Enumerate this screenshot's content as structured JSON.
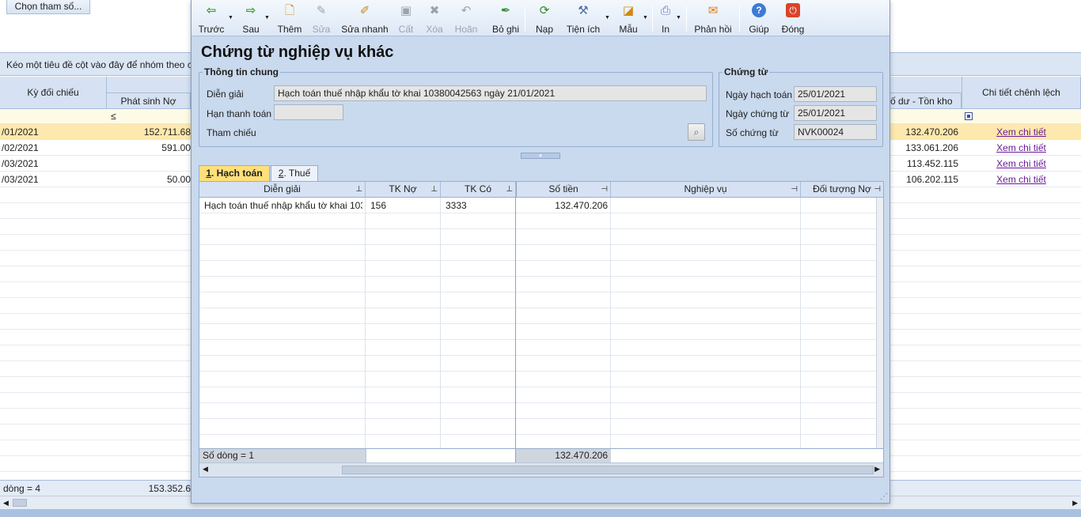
{
  "background": {
    "params_button": "Chọn tham số...",
    "group_bar_text": "Kéo một tiêu đề cột vào đây để nhóm theo c",
    "headers": {
      "ky_doi_chieu": "Kỳ đối chiếu",
      "phat_sinh_no": "Phát sinh Nợ",
      "so_du_ton_kho": "ố dư - Tồn kho",
      "chi_tiet": "Chi tiết chênh lệch"
    },
    "filter_symbol": "≤",
    "rows": [
      {
        "period": "/01/2021",
        "debit": "152.711.68",
        "balance": "132.470.206",
        "link": "Xem chi tiết"
      },
      {
        "period": "/02/2021",
        "debit": "591.00",
        "balance": "133.061.206",
        "link": "Xem chi tiết"
      },
      {
        "period": "/03/2021",
        "debit": "",
        "balance": "113.452.115",
        "link": "Xem chi tiết"
      },
      {
        "period": "/03/2021",
        "debit": "50.00",
        "balance": "106.202.115",
        "link": "Xem chi tiết"
      }
    ],
    "footer_count": "dòng = 4",
    "footer_debit": "153.352.6"
  },
  "toolbar": {
    "truoc": "Trước",
    "sau": "Sau",
    "them": "Thêm",
    "sua": "Sửa",
    "sua_nhanh": "Sửa nhanh",
    "cat": "Cất",
    "xoa": "Xóa",
    "hoan": "Hoãn",
    "bo_ghi": "Bỏ ghi",
    "nap": "Nạp",
    "tien_ich": "Tiện ích",
    "mau": "Mẫu",
    "in": "In",
    "phan_hoi": "Phản hồi",
    "giup": "Giúp",
    "dong": "Đóng"
  },
  "dialog": {
    "title": "Chứng từ nghiệp vụ khác",
    "general": {
      "legend": "Thông tin chung",
      "dien_giai_label": "Diễn giải",
      "dien_giai_value": "Hạch toán thuế nhập khẩu tờ khai 10380042563 ngày 21/01/2021",
      "han_thanh_toan_label": "Hạn thanh toán",
      "han_thanh_toan_value": "",
      "tham_chieu_label": "Tham chiếu"
    },
    "voucher": {
      "legend": "Chứng từ",
      "ngay_hach_toan_label": "Ngày hạch toán",
      "ngay_hach_toan_value": "25/01/2021",
      "ngay_chung_tu_label": "Ngày chứng từ",
      "ngay_chung_tu_value": "25/01/2021",
      "so_chung_tu_label": "Số chứng từ",
      "so_chung_tu_value": "NVK00024"
    },
    "tabs": [
      {
        "num": "1",
        "label": ". Hạch toán"
      },
      {
        "num": "2",
        "label": ". Thuế"
      }
    ],
    "grid": {
      "columns": [
        "Diễn giải",
        "TK Nợ",
        "TK Có",
        "Số tiền",
        "Nghiệp vụ",
        "Đối tượng Nợ"
      ],
      "rows": [
        {
          "dien_giai": "Hạch toán thuế nhập khẩu tờ khai 1038",
          "tk_no": "156",
          "tk_co": "3333",
          "so_tien": "132.470.206",
          "nghiep_vu": "",
          "doi_tuong_no": ""
        }
      ],
      "footer_count": "Số dòng = 1",
      "footer_total": "132.470.206"
    }
  }
}
